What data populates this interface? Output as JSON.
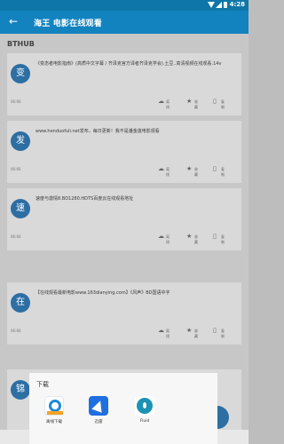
{
  "status_bar": {
    "time": "4:28"
  },
  "app_bar": {
    "back_icon": "arrow-left-icon",
    "title": "海王 电影在线观看"
  },
  "section": {
    "title": "BTHUB"
  },
  "cards": [
    {
      "avatar": "变",
      "text": "《变态者电影指南》(高质中文字幕 / 齐泽克官方译者齐泽克学会).土豆..高清视频在线观看.14v",
      "meta": "06:66",
      "actions": {
        "cloud": "离线",
        "star": "收藏",
        "copy": "复制"
      }
    },
    {
      "avatar": "发",
      "text": "www.henduofuli.net发布，每日更新！我不是潘金莲电影观看",
      "meta": "06:66",
      "actions": {
        "cloud": "离线",
        "star": "收藏",
        "copy": "复制"
      }
    },
    {
      "avatar": "速",
      "text": "速度与激情8.BD1280.HDTS百度云在线观看地址",
      "meta": "06:66",
      "actions": {
        "cloud": "离线",
        "star": "收藏",
        "copy": "复制"
      }
    },
    {
      "avatar": "在",
      "text": "【在线观看最新电影www.163dianying.com】《风声》BD国语中字",
      "meta": "06:66",
      "actions": {
        "cloud": "离线",
        "star": "收藏",
        "copy": "复制"
      }
    },
    {
      "avatar": "锦",
      "text": "",
      "meta": "",
      "actions": {
        "cloud": "",
        "star": "",
        "copy": ""
      }
    }
  ],
  "download_sheet": {
    "title": "下载",
    "apps": [
      {
        "label": "离线下载",
        "icon": "offline-download-icon"
      },
      {
        "label": "迅雷",
        "icon": "xunlei-icon"
      },
      {
        "label": "Fluid",
        "icon": "fluid-icon"
      }
    ]
  },
  "colors": {
    "primary": "#1383bf",
    "avatar": "#2d6ea3"
  }
}
